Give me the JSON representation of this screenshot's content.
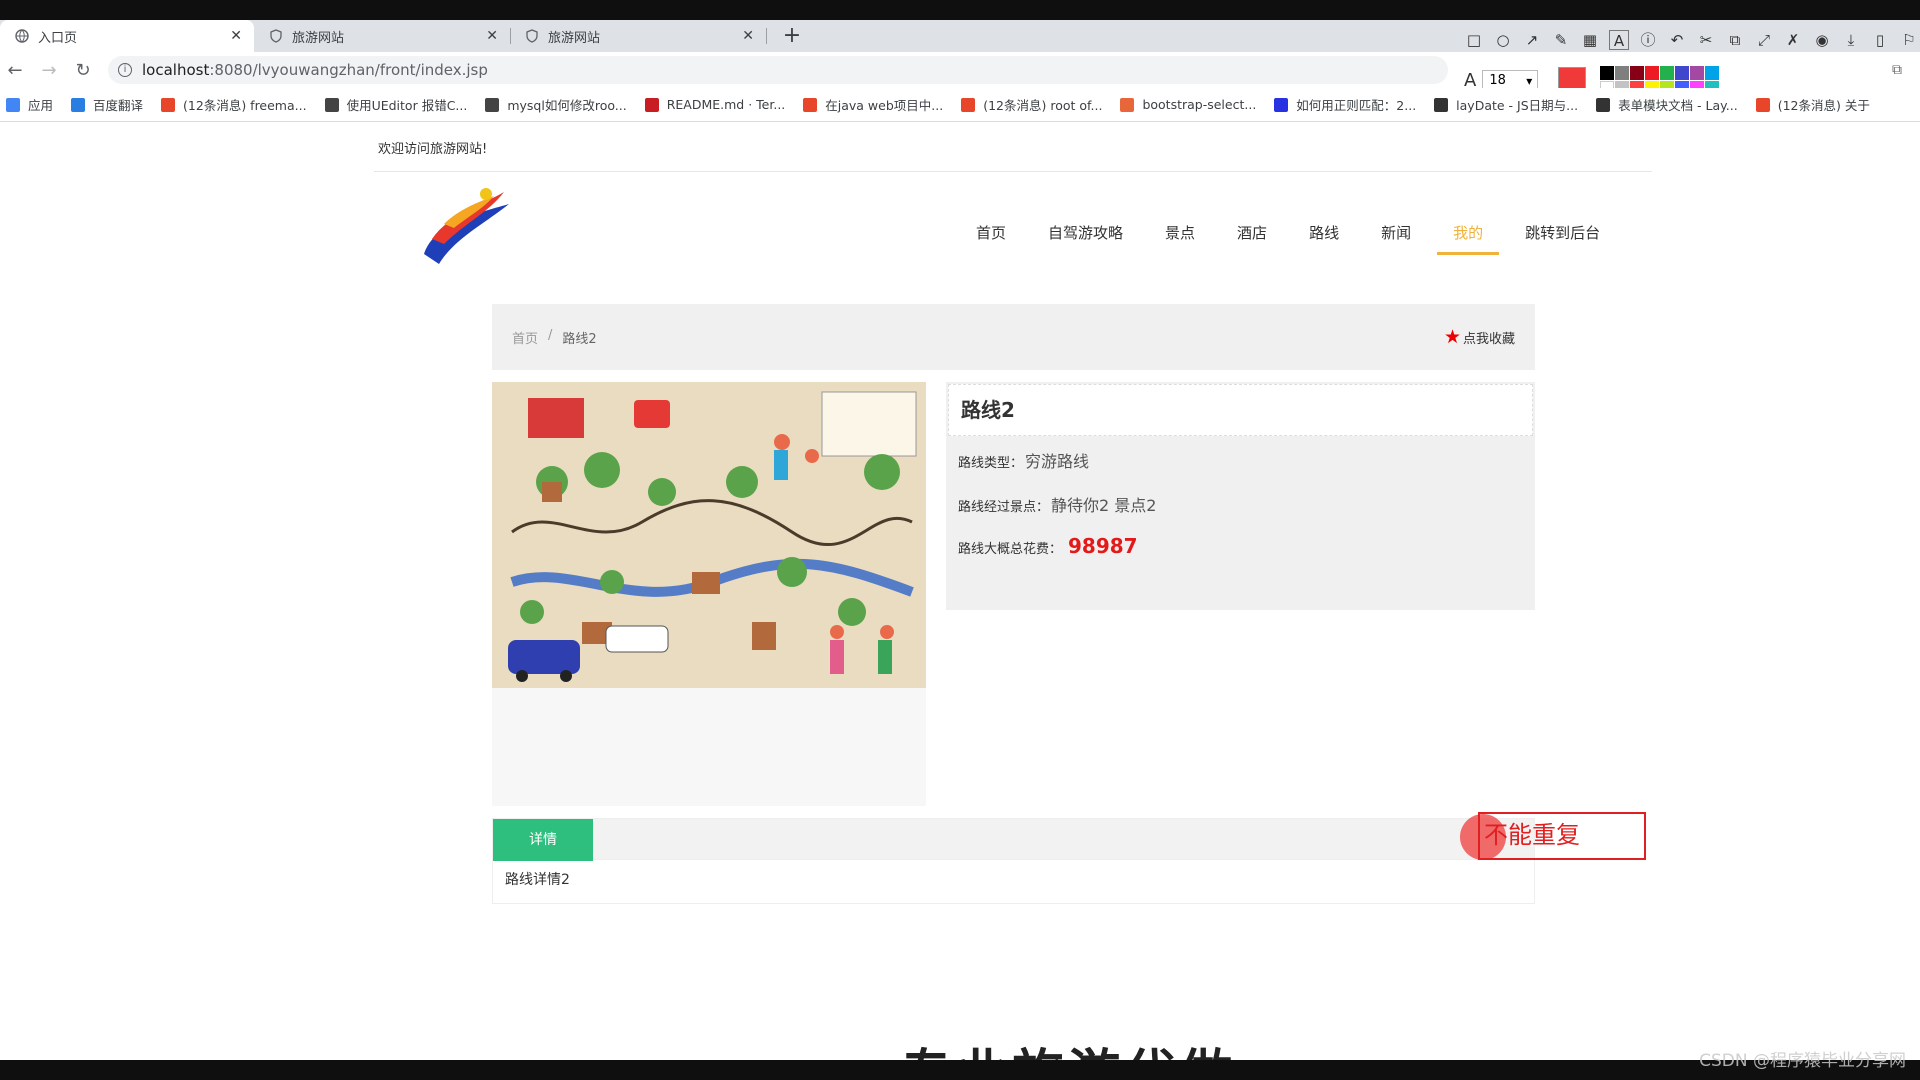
{
  "browser": {
    "tabs": [
      {
        "label": "入口页",
        "active": true
      },
      {
        "label": "旅游网站",
        "active": false
      },
      {
        "label": "旅游网站",
        "active": false
      }
    ],
    "url_host": "localhost",
    "url_path": ":8080/lvyouwangzhan/front/index.jsp",
    "bookmarks": [
      {
        "label": "应用",
        "icon": "apps-icon",
        "color": "#4285f4"
      },
      {
        "label": "百度翻译",
        "icon": "translate-icon",
        "color": "#2a7de1"
      },
      {
        "label": "(12条消息) freema...",
        "icon": "csdn-icon",
        "color": "#e8462a"
      },
      {
        "label": "使用UEditor 报错C...",
        "icon": "link-icon",
        "color": "#444444"
      },
      {
        "label": "mysql如何修改roo...",
        "icon": "link-icon",
        "color": "#444444"
      },
      {
        "label": "README.md · Ter...",
        "icon": "gitee-icon",
        "color": "#c71d23"
      },
      {
        "label": "在java web项目中...",
        "icon": "csdn-icon",
        "color": "#e8462a"
      },
      {
        "label": "(12条消息) root of...",
        "icon": "csdn-icon",
        "color": "#e8462a"
      },
      {
        "label": "bootstrap-select...",
        "icon": "cnblogs-icon",
        "color": "#e8673a"
      },
      {
        "label": "如何用正则匹配：2...",
        "icon": "baidu-paw-icon",
        "color": "#2932e1"
      },
      {
        "label": "layDate - JS日期与...",
        "icon": "layui-icon",
        "color": "#333333"
      },
      {
        "label": "表单模块文档 - Lay...",
        "icon": "layui-icon",
        "color": "#333333"
      },
      {
        "label": "(12条消息) 关于",
        "icon": "csdn-icon",
        "color": "#e8462a"
      }
    ],
    "font_size": "18"
  },
  "site": {
    "welcome": "欢迎访问旅游网站!",
    "nav": [
      {
        "label": "首页",
        "active": false
      },
      {
        "label": "自驾游攻略",
        "active": false
      },
      {
        "label": "景点",
        "active": false
      },
      {
        "label": "酒店",
        "active": false
      },
      {
        "label": "路线",
        "active": false
      },
      {
        "label": "新闻",
        "active": false
      },
      {
        "label": "我的",
        "active": true
      },
      {
        "label": "跳转到后台",
        "active": false
      }
    ],
    "accent": "#f0b23a"
  },
  "breadcrumb": {
    "home": "首页",
    "sep": "/",
    "current": "路线2",
    "favorite": "点我收藏"
  },
  "route": {
    "title": "路线2",
    "type_label": "路线类型：",
    "type_value": "穷游路线",
    "spots_label": "路线经过景点：",
    "spots_value": "静待你2 景点2",
    "cost_label": "路线大概总花费：",
    "cost_value": "98987"
  },
  "detail": {
    "tab_label": "详情",
    "content": "路线详情2",
    "tab_color": "#2ebf7f"
  },
  "annotation": {
    "text": "不能重复",
    "color": "#e02020"
  },
  "footer": {
    "big_text": "专业旅游代做",
    "watermark": "CSDN @程序猿毕业分享网"
  }
}
